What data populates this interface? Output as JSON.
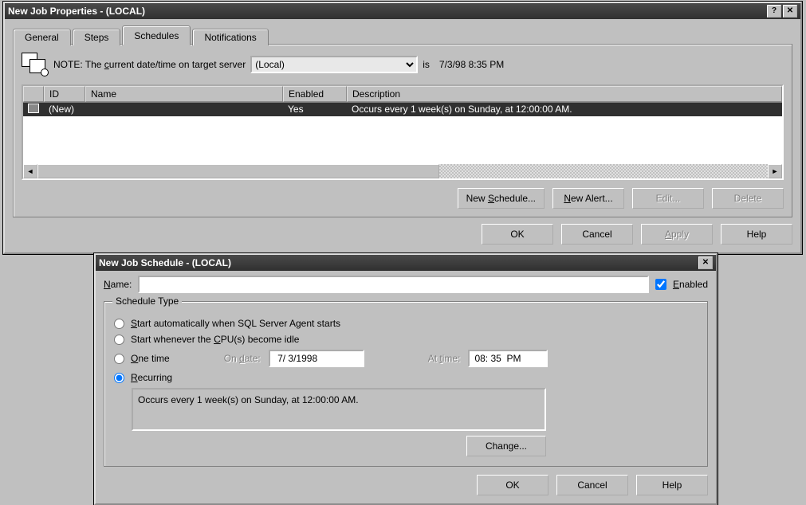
{
  "dlg1": {
    "title": "New Job Properties - (LOCAL)",
    "tabs": {
      "general": "General",
      "steps": "Steps",
      "schedules": "Schedules",
      "notifications": "Notifications"
    },
    "note_prefix": "NOTE: The ",
    "note_c": "c",
    "note_suffix": "urrent date/time on target server",
    "server": "(Local)",
    "is": "is",
    "now": "7/3/98 8:35 PM",
    "cols": {
      "id": "ID",
      "name": "Name",
      "enabled": "Enabled",
      "desc": "Description"
    },
    "row": {
      "id": "(New)",
      "name": "",
      "enabled": "Yes",
      "desc": "Occurs every 1 week(s) on Sunday, at 12:00:00 AM."
    },
    "btn_new_sched_pre": "New ",
    "btn_new_sched_u": "S",
    "btn_new_sched_post": "chedule...",
    "btn_new_alert": "New Alert...",
    "btn_edit": "Edit...",
    "btn_delete": "Delete",
    "btn_ok": "OK",
    "btn_cancel": "Cancel",
    "btn_apply": "Apply",
    "btn_help": "Help"
  },
  "dlg2": {
    "title": "New Job Schedule - (LOCAL)",
    "name_u": "N",
    "name_post": "ame:",
    "enabled_u": "E",
    "enabled_post": "nabled",
    "group": "Schedule Type",
    "r1_u": "S",
    "r1_post": "tart automatically when SQL Server Agent starts",
    "r2_pre": "Start whenever the ",
    "r2_u": "C",
    "r2_post": "PU(s) become idle",
    "r3_u": "O",
    "r3_post": "ne time",
    "ondate_pre": "On ",
    "ondate_u": "d",
    "ondate_post": "ate:",
    "date_val": " 7/ 3/1998",
    "attime_pre": "At ",
    "attime_u": "t",
    "attime_post": "ime:",
    "time_val": "08: 35  PM",
    "r4_u": "R",
    "r4_post": "ecurring",
    "recurring_desc": "Occurs every 1 week(s) on Sunday, at 12:00:00 AM.",
    "btn_change": "Change...",
    "btn_ok": "OK",
    "btn_cancel": "Cancel",
    "btn_help": "Help"
  }
}
